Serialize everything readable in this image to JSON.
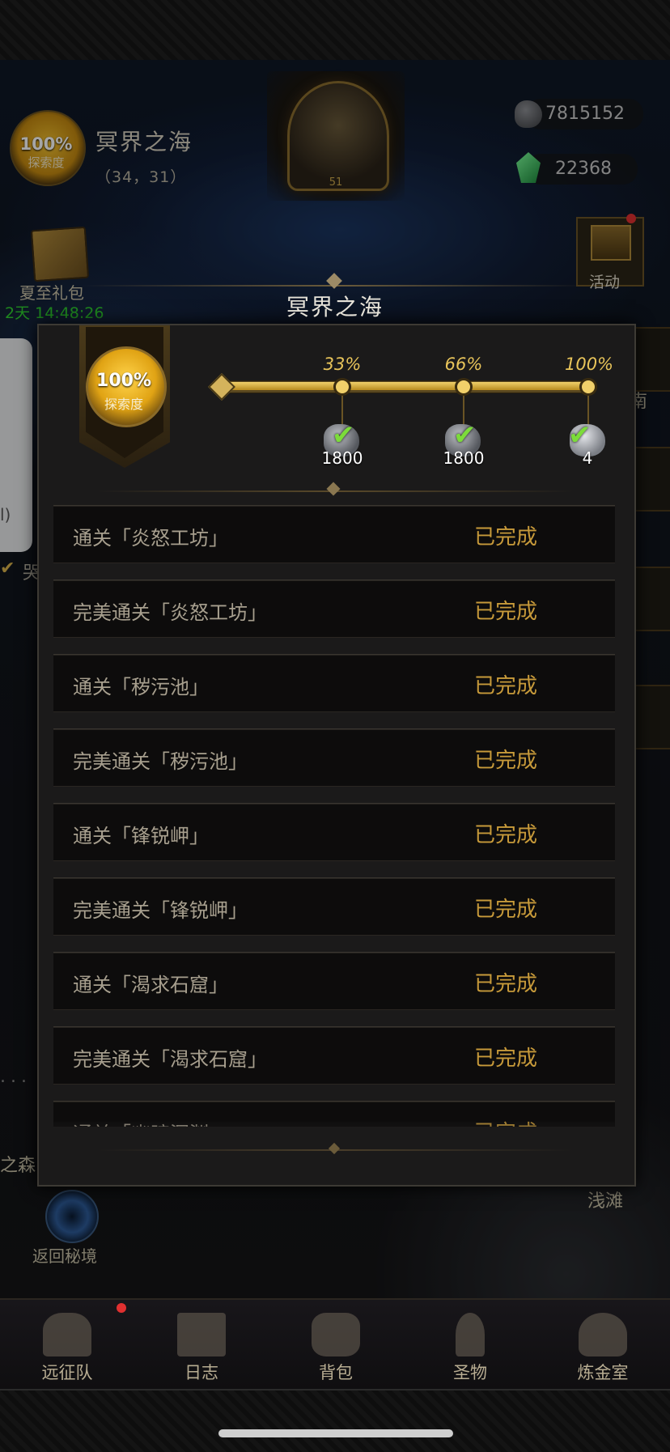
{
  "region": {
    "medal_pct": "100%",
    "medal_label": "探索度",
    "name": "冥界之海",
    "coords": "（34，31）"
  },
  "portrait_level": "51",
  "currency": {
    "stone": "7815152",
    "gem": "22368"
  },
  "gift_pack": {
    "label": "夏至礼包",
    "timer": "2天 14:48:26"
  },
  "activity_label": "活动",
  "side_text": {
    "panel": "l)",
    "right_partial": "南",
    "left_partial": "哭"
  },
  "map_labels": {
    "forest": "之森",
    "shoal": "浅滩",
    "portal": "返回秘境",
    "dots": "..."
  },
  "nav": [
    {
      "label": "远征队",
      "icon": "helmet-icon"
    },
    {
      "label": "日志",
      "icon": "scroll-icon"
    },
    {
      "label": "背包",
      "icon": "bag-icon"
    },
    {
      "label": "圣物",
      "icon": "chalice-icon"
    },
    {
      "label": "炼金室",
      "icon": "alchemy-icon"
    }
  ],
  "dialog": {
    "title": "冥界之海",
    "medal_pct": "100%",
    "medal_label": "探索度",
    "progress": 1.0,
    "milestones": [
      {
        "pct": "33%",
        "reward": "1800",
        "icon": "ore-icon",
        "claimed": true
      },
      {
        "pct": "66%",
        "reward": "1800",
        "icon": "ore-icon",
        "claimed": true
      },
      {
        "pct": "100%",
        "reward": "4",
        "icon": "crystal-ore-icon",
        "claimed": true
      }
    ],
    "check_glyph": "✔",
    "tasks": [
      {
        "name": "通关「炎怒工坊」",
        "status": "已完成"
      },
      {
        "name": "完美通关「炎怒工坊」",
        "status": "已完成"
      },
      {
        "name": "通关「秽污池」",
        "status": "已完成"
      },
      {
        "name": "完美通关「秽污池」",
        "status": "已完成"
      },
      {
        "name": "通关「锋锐岬」",
        "status": "已完成"
      },
      {
        "name": "完美通关「锋锐岬」",
        "status": "已完成"
      },
      {
        "name": "通关「渴求石窟」",
        "status": "已完成"
      },
      {
        "name": "完美通关「渴求石窟」",
        "status": "已完成"
      },
      {
        "name": "通关「幽暗深渊」",
        "status": "已完成"
      }
    ]
  },
  "colors": {
    "gold": "#e8c45a",
    "status": "#c79a3a",
    "green": "#2fd12f",
    "red_dot": "#e03030"
  }
}
